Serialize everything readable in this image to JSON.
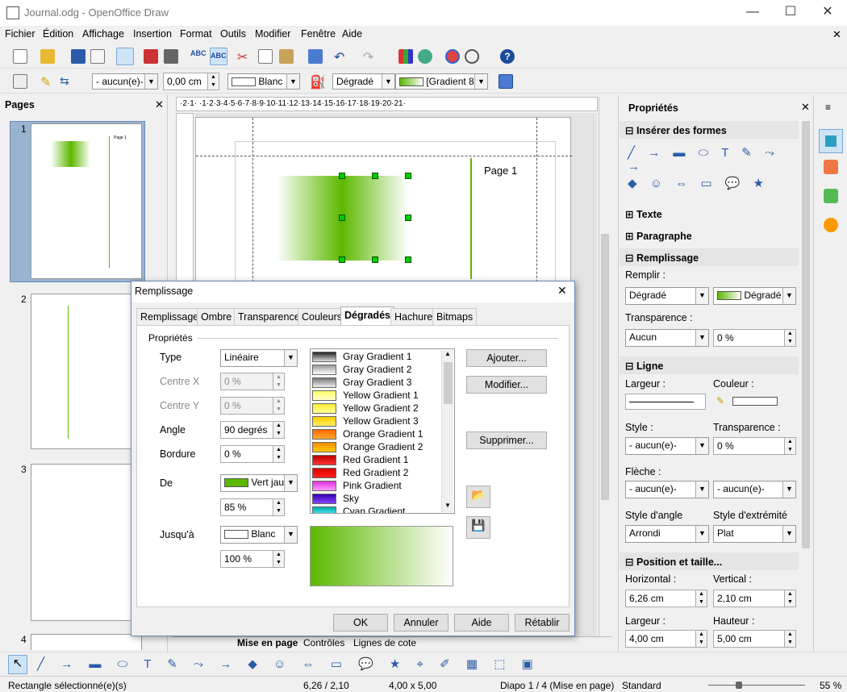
{
  "window": {
    "title": "Journal.odg - OpenOffice Draw",
    "min": "—",
    "max": "☐",
    "close": "✕",
    "doc_close": "✕"
  },
  "menu": [
    "Fichier",
    "Édition",
    "Affichage",
    "Insertion",
    "Format",
    "Outils",
    "Modifier",
    "Fenêtre",
    "Aide"
  ],
  "toolbar2": {
    "line_style": "- aucun(e)-",
    "line_width": "0,00 cm",
    "line_color": "Blanc",
    "fill_type": "Dégradé",
    "fill_gradient": "[Gradient 8"
  },
  "pages": {
    "title": "Pages",
    "close": "✕",
    "numbers": [
      "1",
      "2",
      "3",
      "4"
    ],
    "page1_label": "Page 1"
  },
  "ruler": {
    "h_ticks": "·2·1·  ·1·2·3·4·5·6·7·8·9·10·11·12·13·14·15·16·17·18·19·20·21·"
  },
  "canvas": {
    "page_label": "Page 1"
  },
  "tabs": [
    "Mise en page",
    "Contrôles",
    "Lignes de cote"
  ],
  "sidebar": {
    "title": "Propriétés",
    "close": "✕",
    "insert_shapes": "Insérer des formes",
    "text": "Texte",
    "paragraph": "Paragraphe",
    "fill": "Remplissage",
    "fill_label": "Remplir :",
    "fill_type": "Dégradé",
    "fill_value": "Dégradé",
    "transparency_label": "Transparence :",
    "transparency_mode": "Aucun",
    "transparency_value": "0 %",
    "line": "Ligne",
    "width_label": "Largeur :",
    "color_label": "Couleur :",
    "style_label": "Style :",
    "style_value": "- aucun(e)-",
    "line_transp_label": "Transparence :",
    "line_transp_value": "0 %",
    "arrow_label": "Flèche :",
    "arrow_start": "- aucun(e)-",
    "arrow_end": "- aucun(e)-",
    "corner_label": "Style d'angle",
    "corner_value": "Arrondi",
    "cap_label": "Style d'extrémité",
    "cap_value": "Plat",
    "pos": "Position et taille...",
    "horiz_label": "Horizontal :",
    "horiz_value": "6,26 cm",
    "vert_label": "Vertical :",
    "vert_value": "2,10 cm",
    "w_label": "Largeur :",
    "w_value": "4,00 cm",
    "h_label": "Hauteur :",
    "h_value": "5,00 cm"
  },
  "dialog": {
    "title": "Remplissage",
    "close": "✕",
    "tabs": [
      "Remplissage",
      "Ombre",
      "Transparence",
      "Couleurs",
      "Dégradés",
      "Hachure",
      "Bitmaps"
    ],
    "group": "Propriétés",
    "type_label": "Type",
    "type_value": "Linéaire",
    "cx_label": "Centre X",
    "cx_value": "0 %",
    "cy_label": "Centre Y",
    "cy_value": "0 %",
    "angle_label": "Angle",
    "angle_value": "90 degrés",
    "border_label": "Bordure",
    "border_value": "0 %",
    "from_label": "De",
    "from_color": "Vert jau",
    "from_pct": "85 %",
    "to_label": "Jusqu'à",
    "to_color": "Blanc",
    "to_pct": "100 %",
    "gradients": [
      {
        "name": "Gray Gradient 1",
        "c1": "#222",
        "c2": "#ddd"
      },
      {
        "name": "Gray Gradient 2",
        "c1": "#999",
        "c2": "#fff"
      },
      {
        "name": "Gray Gradient 3",
        "c1": "#777",
        "c2": "#eee"
      },
      {
        "name": "Yellow Gradient 1",
        "c1": "#ffff66",
        "c2": "#ffffcc"
      },
      {
        "name": "Yellow Gradient 2",
        "c1": "#ffee33",
        "c2": "#ffff99"
      },
      {
        "name": "Yellow Gradient 3",
        "c1": "#ffcc00",
        "c2": "#ffee66"
      },
      {
        "name": "Orange Gradient 1",
        "c1": "#ff6600",
        "c2": "#ffaa33"
      },
      {
        "name": "Orange Gradient 2",
        "c1": "#ff8800",
        "c2": "#ffcc00"
      },
      {
        "name": "Red Gradient 1",
        "c1": "#bb0000",
        "c2": "#ff3333"
      },
      {
        "name": "Red Gradient 2",
        "c1": "#dd0000",
        "c2": "#ff2222"
      },
      {
        "name": "Pink Gradient",
        "c1": "#dd33dd",
        "c2": "#ff99ff"
      },
      {
        "name": "Sky",
        "c1": "#3300aa",
        "c2": "#8844ff"
      },
      {
        "name": "Cyan Gradient",
        "c1": "#00aaaa",
        "c2": "#66ffff"
      }
    ],
    "add": "Ajouter...",
    "modify": "Modifier...",
    "delete": "Supprimer...",
    "ok": "OK",
    "cancel": "Annuler",
    "help": "Aide",
    "reset": "Rétablir"
  },
  "status": {
    "selection": "Rectangle sélectionné(e)(s)",
    "position": "6,26 / 2,10",
    "size": "4,00 x 5,00",
    "slide": "Diapo 1 / 4 (Mise en page)",
    "style": "Standard",
    "zoom": "55 %"
  },
  "colors": {
    "green": "#5cb800",
    "accent": "#99b4d1"
  }
}
